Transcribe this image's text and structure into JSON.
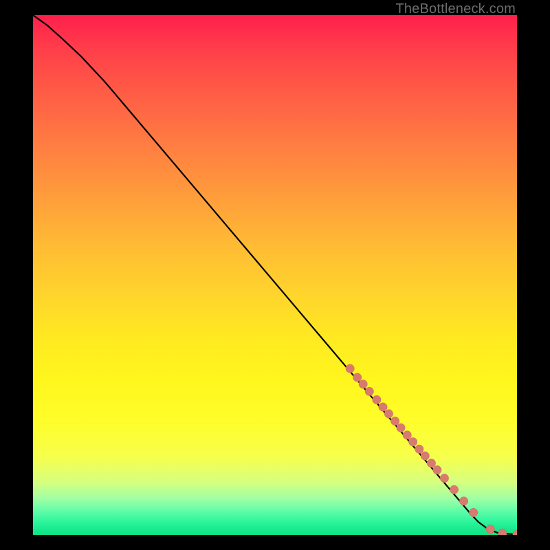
{
  "watermark": "TheBottleneck.com",
  "colors": {
    "curve": "#000000",
    "marker_fill": "#d97a6f",
    "marker_stroke": "#c56a60",
    "background_margin": "#000000"
  },
  "chart_data": {
    "type": "line",
    "title": "",
    "xlabel": "",
    "ylabel": "",
    "xlim": [
      0,
      100
    ],
    "ylim": [
      0,
      100
    ],
    "grid": false,
    "legend": false,
    "series": [
      {
        "name": "bottleneck-curve",
        "x": [
          0,
          3,
          6,
          10,
          15,
          20,
          25,
          30,
          35,
          40,
          45,
          50,
          55,
          60,
          65,
          70,
          72,
          74,
          76,
          78,
          80,
          82,
          84,
          86,
          88,
          90,
          92,
          94,
          96,
          98,
          100
        ],
        "values": [
          100,
          98,
          95.5,
          92,
          87,
          81.5,
          76,
          70.5,
          65,
          59.5,
          54,
          48.5,
          43,
          37.5,
          32,
          26.5,
          24.3,
          22.1,
          19.9,
          17.7,
          15.5,
          13.3,
          11.1,
          8.9,
          6.7,
          4.5,
          2.5,
          1.1,
          0.4,
          0.2,
          0.1
        ]
      }
    ],
    "markers": {
      "name": "highlighted-points",
      "x": [
        65.5,
        67,
        68.2,
        69.5,
        71,
        72.3,
        73.5,
        74.8,
        76,
        77.3,
        78.5,
        79.8,
        81,
        82.3,
        83.5,
        85,
        87,
        89,
        91,
        94.5,
        97,
        100
      ],
      "values": [
        32,
        30.3,
        29.0,
        27.6,
        26.0,
        24.6,
        23.3,
        21.9,
        20.6,
        19.2,
        17.9,
        16.5,
        15.2,
        13.8,
        12.5,
        10.9,
        8.7,
        6.5,
        4.3,
        1.1,
        0.35,
        0.1
      ]
    }
  }
}
